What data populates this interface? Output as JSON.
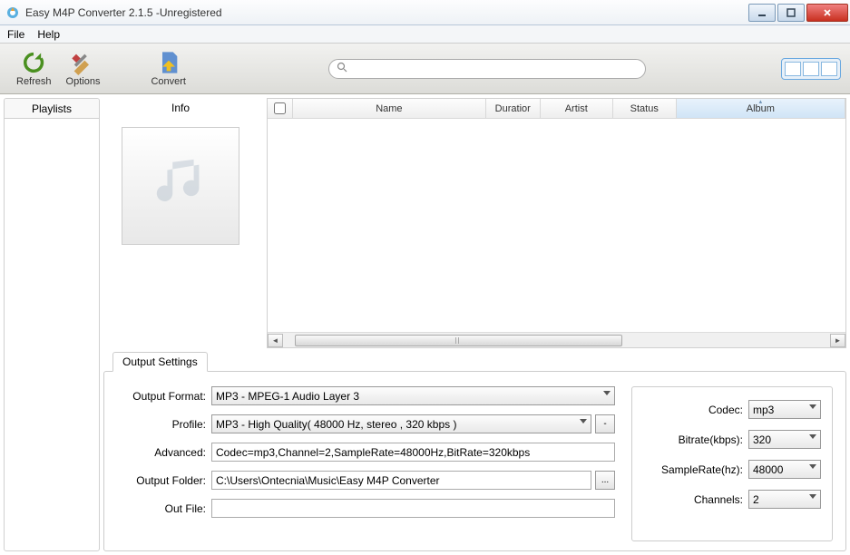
{
  "window": {
    "title": "Easy M4P Converter 2.1.5 -Unregistered"
  },
  "menu": {
    "file": "File",
    "help": "Help"
  },
  "toolbar": {
    "refresh": "Refresh",
    "options": "Options",
    "convert": "Convert"
  },
  "search": {
    "placeholder": ""
  },
  "sidebar": {
    "playlists": "Playlists"
  },
  "info": {
    "title": "Info"
  },
  "table": {
    "cols": {
      "name": "Name",
      "duration": "Duratior",
      "artist": "Artist",
      "status": "Status",
      "album": "Album"
    }
  },
  "settings": {
    "tab": "Output Settings",
    "labels": {
      "format": "Output Format:",
      "profile": "Profile:",
      "advanced": "Advanced:",
      "folder": "Output Folder:",
      "outfile": "Out File:",
      "codec": "Codec:",
      "bitrate": "Bitrate(kbps):",
      "samplerate": "SampleRate(hz):",
      "channels": "Channels:"
    },
    "values": {
      "format": "MP3 - MPEG-1 Audio Layer 3",
      "profile": "MP3 - High Quality( 48000 Hz, stereo , 320 kbps  )",
      "advanced": "Codec=mp3,Channel=2,SampleRate=48000Hz,BitRate=320kbps",
      "folder": "C:\\Users\\Ontecnia\\Music\\Easy M4P Converter",
      "outfile": "",
      "codec": "mp3",
      "bitrate": "320",
      "samplerate": "48000",
      "channels": "2",
      "profile_btn": "-",
      "folder_btn": "..."
    }
  }
}
